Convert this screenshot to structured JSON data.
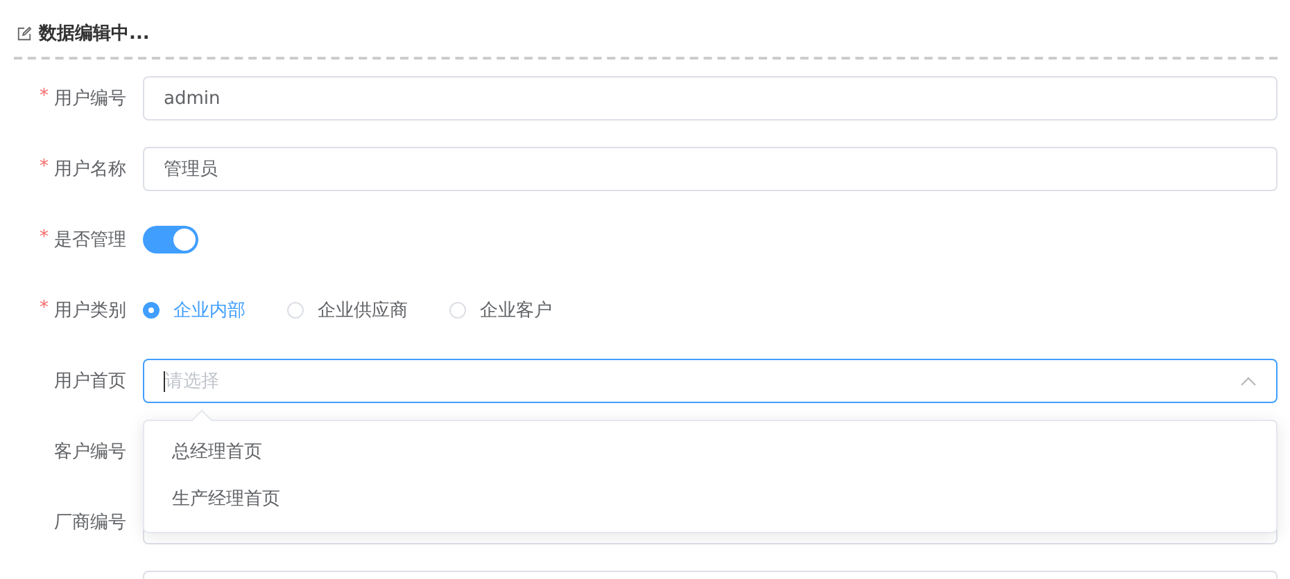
{
  "header": {
    "title": "数据编辑中..."
  },
  "fields": [
    {
      "kind": "text",
      "label": "用户编号",
      "required_mark": "*",
      "value": "admin"
    },
    {
      "kind": "text",
      "label": "用户名称",
      "required_mark": "*",
      "value": "管理员"
    },
    {
      "kind": "switch",
      "label": "是否管理",
      "required_mark": "*",
      "on": true
    },
    {
      "kind": "radio",
      "label": "用户类别",
      "required_mark": "*",
      "options": [
        {
          "label": "企业内部",
          "selected": true
        },
        {
          "label": "企业供应商",
          "selected": false
        },
        {
          "label": "企业客户",
          "selected": false
        }
      ]
    },
    {
      "kind": "select",
      "label": "用户首页",
      "placeholder": "请选择",
      "expanded": true,
      "options": [
        "总经理首页",
        "生产经理首页"
      ]
    },
    {
      "kind": "covered",
      "label": "客户编号"
    },
    {
      "kind": "text",
      "label": "厂商编号"
    },
    {
      "kind": "text"
    }
  ]
}
